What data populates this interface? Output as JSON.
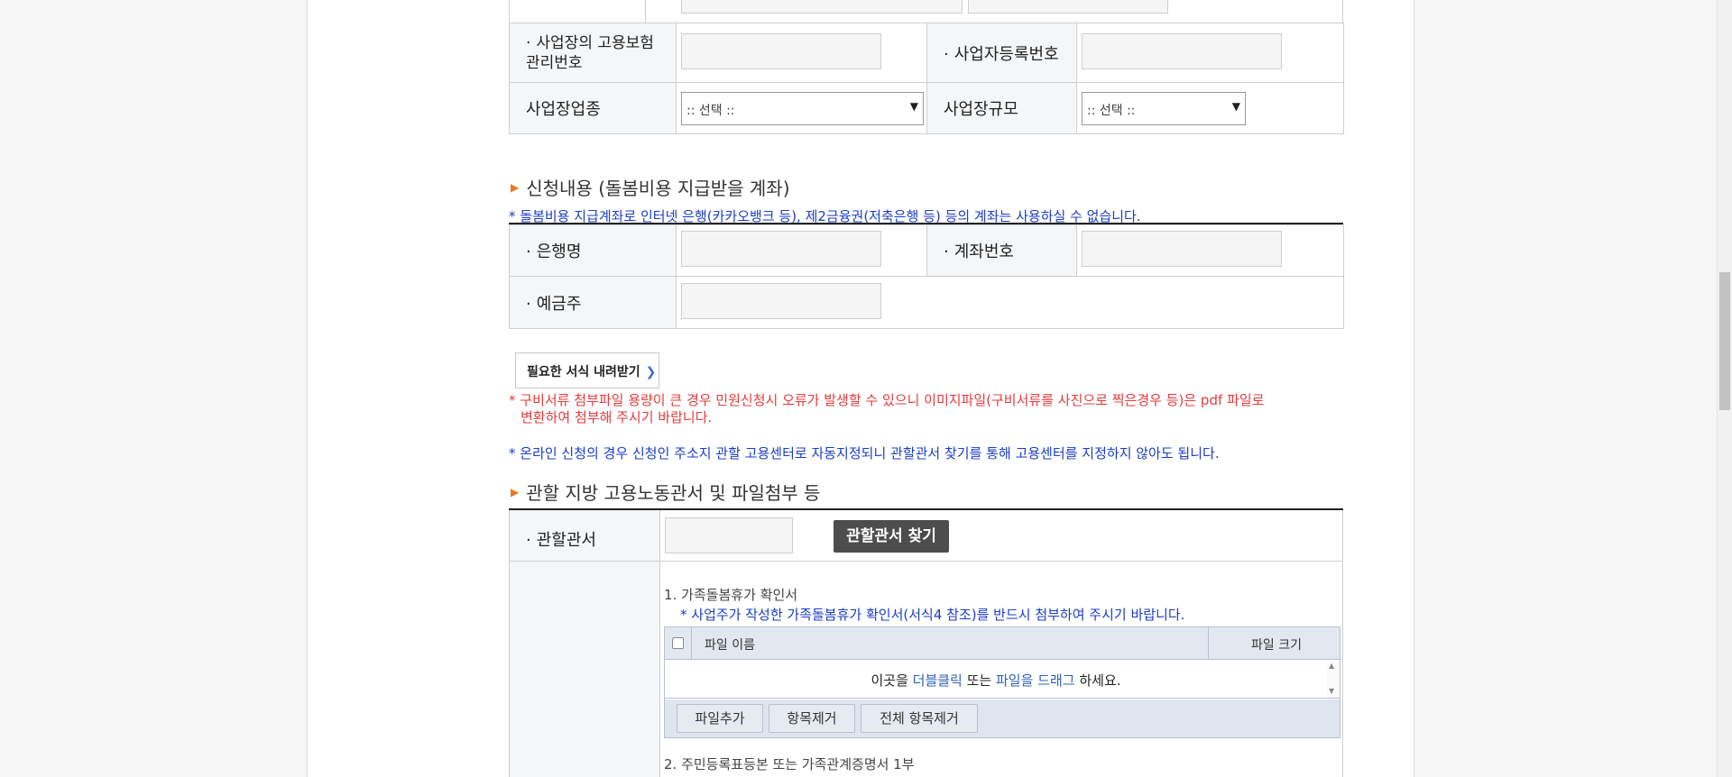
{
  "workplace": {
    "insurance_label": "사업장의 고용보험",
    "insurance_label2": "관리번호",
    "business_reg_label": "사업자등록번호",
    "industry_label": "사업장업종",
    "industry_select": ":: 선택 ::",
    "scale_label": "사업장규모",
    "scale_select": ":: 선택 ::"
  },
  "application": {
    "title": "신청내용 (돌봄비용 지급받을 계좌)",
    "notice": "* 돌봄비용 지급계좌로 인터넷 은행(카카오뱅크 등), 제2금융권(저축은행 등) 등의 계좌는 사용하실 수 없습니다.",
    "bank_label": "은행명",
    "account_label": "계좌번호",
    "holder_label": "예금주"
  },
  "forms": {
    "download_label": "필요한 서식 내려받기",
    "download_arrow": "❯",
    "warning_line1": "* 구비서류 첨부파일 용량이 큰 경우 민원신청시 오류가 발생할 수 있으니 이미지파일(구비서류를 사진으로 찍은경우 등)은 pdf 파일로",
    "warning_line2": "변환하여 첨부해 주시기 바랍니다.",
    "online_notice": "* 온라인 신청의 경우 신청인 주소지 관할 고용센터로 자동지정되니 관할관서 찾기를 통해 고용센터를 지정하지 않아도 됩니다."
  },
  "office": {
    "title": "관할 지방 고용노동관서 및 파일첨부 등",
    "office_label": "관할관서",
    "find_button": "관할관서 찾기"
  },
  "attachments": {
    "item1_title": "1. 가족돌봄휴가 확인서",
    "item1_notice": "* 사업주가 작성한 가족돌봄휴가 확인서(서식4 참조)를 반드시 첨부하여 주시기 바랍니다.",
    "col_filename": "파일 이름",
    "col_filesize": "파일 크기",
    "drop_pre": "이곳을 ",
    "drop_dblclick": "더블클릭",
    "drop_mid": " 또는 ",
    "drop_drag": "파일을 드래그",
    "drop_post": " 하세요.",
    "btn_add": "파일추가",
    "btn_remove": "항목제거",
    "btn_remove_all": "전체 항목제거",
    "item2_title": "2. 주민등록표등본 또는 가족관계증명서 1부"
  },
  "bullet": "·",
  "colors": {
    "blue": "#1a3dc9",
    "red": "#e43b3b",
    "orange": "#e8791c",
    "link": "#2d5fb8"
  }
}
